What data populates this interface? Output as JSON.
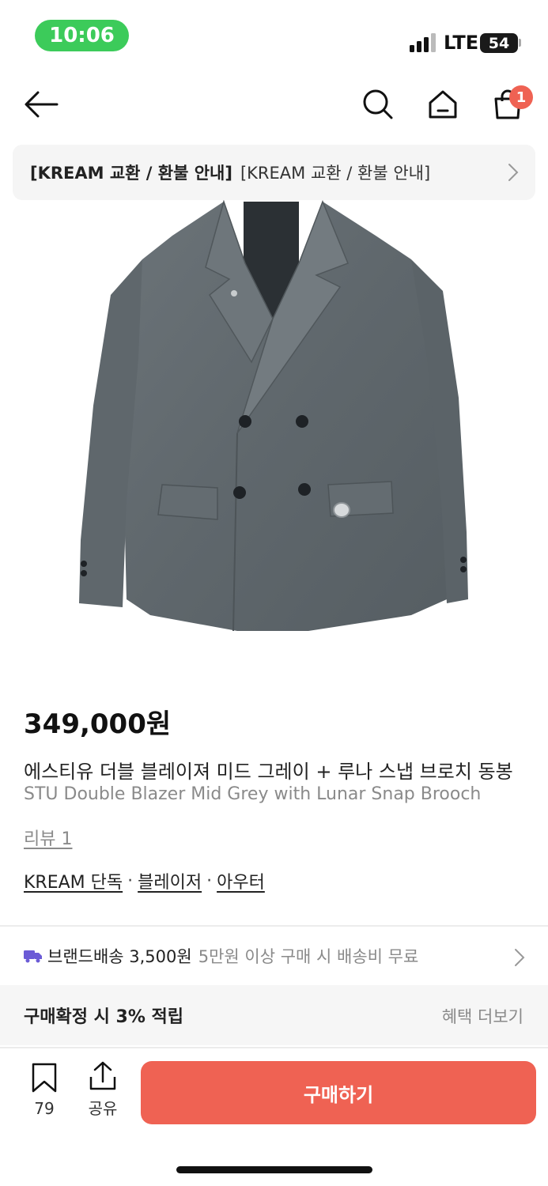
{
  "status_bar": {
    "time": "10:06",
    "network": "LTE",
    "battery": "54"
  },
  "nav": {
    "cart_badge": "1"
  },
  "notice": {
    "bold": "[KREAM 교환 / 환불 안내]",
    "text": "[KREAM 교환 / 환불 안내]"
  },
  "product": {
    "image_alt": "grey double-breasted blazer",
    "price": "349,000원",
    "name_ko": "에스티유 더블 블레이져 미드 그레이 + 루나 스냅 브로치 동봉",
    "name_en": "STU Double Blazer Mid Grey with Lunar Snap Brooch",
    "review": "리뷰 1",
    "tags": [
      "KREAM 단독",
      "블레이저",
      "아우터"
    ]
  },
  "delivery": {
    "label": "브랜드배송 3,500원",
    "free": "5만원 이상 구매 시 배송비 무료"
  },
  "benefit": {
    "title": "구매확정 시 3% 적립",
    "more": "혜택 더보기"
  },
  "bottom": {
    "bookmark_count": "79",
    "share_label": "공유",
    "buy_label": "구매하기"
  },
  "colors": {
    "accent": "#ef6253",
    "status_green": "#3ccb5a",
    "delivery_icon": "#6b5bd6"
  }
}
